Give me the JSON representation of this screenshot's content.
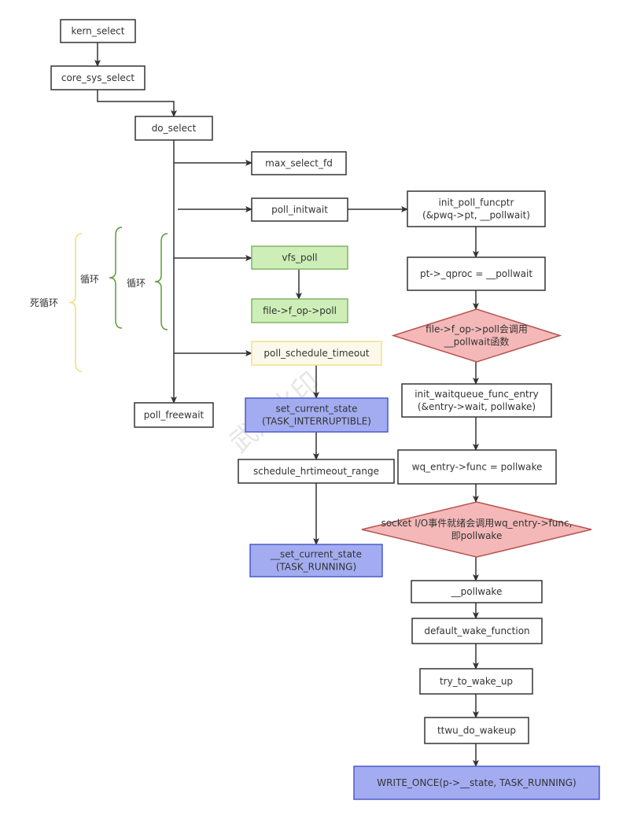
{
  "nodes": {
    "kern_select": {
      "lines": [
        "kern_select"
      ],
      "style": "plain"
    },
    "core_sys_select": {
      "lines": [
        "core_sys_select"
      ],
      "style": "plain"
    },
    "do_select": {
      "lines": [
        "do_select"
      ],
      "style": "plain"
    },
    "max_select_fd": {
      "lines": [
        "max_select_fd"
      ],
      "style": "plain"
    },
    "poll_initwait": {
      "lines": [
        "poll_initwait"
      ],
      "style": "plain"
    },
    "vfs_poll": {
      "lines": [
        "vfs_poll"
      ],
      "style": "green"
    },
    "f_op_poll": {
      "lines": [
        "file->f_op->poll"
      ],
      "style": "green"
    },
    "poll_schedule_timeout": {
      "lines": [
        "poll_schedule_timeout"
      ],
      "style": "yellow"
    },
    "set_current_state": {
      "lines": [
        "set_current_state",
        "(TASK_INTERRUPTIBLE)"
      ],
      "style": "blue"
    },
    "schedule_hrtimeout_range": {
      "lines": [
        "schedule_hrtimeout_range"
      ],
      "style": "plain"
    },
    "__set_current_state": {
      "lines": [
        "__set_current_state",
        "(TASK_RUNNING)"
      ],
      "style": "blue"
    },
    "poll_freewait": {
      "lines": [
        "poll_freewait"
      ],
      "style": "plain"
    },
    "init_poll_funcptr": {
      "lines": [
        "init_poll_funcptr",
        "(&pwq->pt, __pollwait)"
      ],
      "style": "plain"
    },
    "pt_qproc": {
      "lines": [
        "pt->_qproc = __pollwait"
      ],
      "style": "plain"
    },
    "decision_pollwait": {
      "lines": [
        "file->f_op->poll会调用",
        "__pollwait函数"
      ],
      "style": "red"
    },
    "init_waitqueue_func_entry": {
      "lines": [
        "init_waitqueue_func_entry",
        "(&entry->wait, pollwake)"
      ],
      "style": "plain"
    },
    "wq_entry_func": {
      "lines": [
        "wq_entry->func  = pollwake"
      ],
      "style": "plain"
    },
    "decision_pollwake": {
      "lines": [
        "socket I/O事件就绪会调用wq_entry->func,",
        "即pollwake"
      ],
      "style": "red"
    },
    "__pollwake": {
      "lines": [
        "__pollwake"
      ],
      "style": "plain"
    },
    "default_wake_function": {
      "lines": [
        "default_wake_function"
      ],
      "style": "plain"
    },
    "try_to_wake_up": {
      "lines": [
        "try_to_wake_up"
      ],
      "style": "plain"
    },
    "ttwu_do_wakeup": {
      "lines": [
        "ttwu_do_wakeup"
      ],
      "style": "plain"
    },
    "write_once": {
      "lines": [
        "WRITE_ONCE(p->__state, TASK_RUNNING)"
      ],
      "style": "blue"
    }
  },
  "braces": {
    "infinite_loop": {
      "label": "死循环",
      "color": "#f0dc82"
    },
    "outer_loop": {
      "label": "循环",
      "color": "#5e9a3a"
    },
    "inner_loop": {
      "label": "循环",
      "color": "#5e9a3a"
    }
  },
  "watermark": "武用水印",
  "colors": {
    "plain": {
      "fill": "#ffffff",
      "stroke": "#333333"
    },
    "green": {
      "fill": "#cdeeb7",
      "stroke": "#82b366"
    },
    "yellow": {
      "fill": "#fdf9ea",
      "stroke": "#f0e08c"
    },
    "blue": {
      "fill": "#a3acf0",
      "stroke": "#4b5bcc"
    },
    "red": {
      "fill": "#f4b8b8",
      "stroke": "#b85450"
    },
    "edge": "#333333"
  }
}
